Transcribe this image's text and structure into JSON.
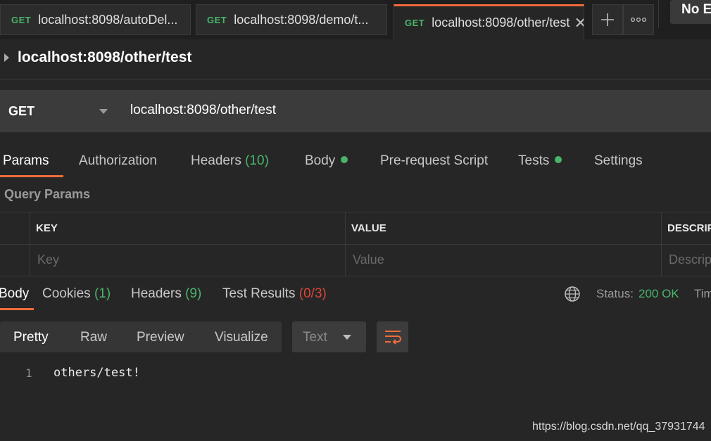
{
  "tabs": [
    {
      "method": "GET",
      "url": "localhost:8098/autoDel..."
    },
    {
      "method": "GET",
      "url": "localhost:8098/demo/t..."
    },
    {
      "method": "GET",
      "url": "localhost:8098/other/test"
    }
  ],
  "new_tab_icon": "plus-icon",
  "more_icon": "ellipsis-icon",
  "environment": "No E",
  "request_title": "localhost:8098/other/test",
  "request": {
    "method": "GET",
    "url": "localhost:8098/other/test"
  },
  "request_tabs": {
    "params": "Params",
    "authorization": "Authorization",
    "headers": "Headers",
    "headers_count": "(10)",
    "body": "Body",
    "pre_request": "Pre-request Script",
    "tests": "Tests",
    "settings": "Settings"
  },
  "query_params": {
    "label": "Query Params",
    "columns": {
      "key": "KEY",
      "value": "VALUE",
      "description": "DESCRIPT"
    },
    "placeholders": {
      "key": "Key",
      "value": "Value",
      "description": "Descrip"
    }
  },
  "response_tabs": {
    "body": "Body",
    "cookies": "Cookies",
    "cookies_count": "(1)",
    "headers": "Headers",
    "headers_count": "(9)",
    "test_results": "Test Results",
    "test_results_count": "(0/3)"
  },
  "response_status": {
    "label": "Status:",
    "value": "200 OK",
    "time_label": "Tim"
  },
  "format": {
    "pretty": "Pretty",
    "raw": "Raw",
    "preview": "Preview",
    "visualize": "Visualize",
    "language": "Text"
  },
  "response_body": {
    "line_number": "1",
    "content": "others/test!"
  },
  "watermark": "https://blog.csdn.net/qq_37931744",
  "colors": {
    "accent": "#f26b3a",
    "success": "#48b56b",
    "error": "#d9473b",
    "background": "#262626"
  }
}
